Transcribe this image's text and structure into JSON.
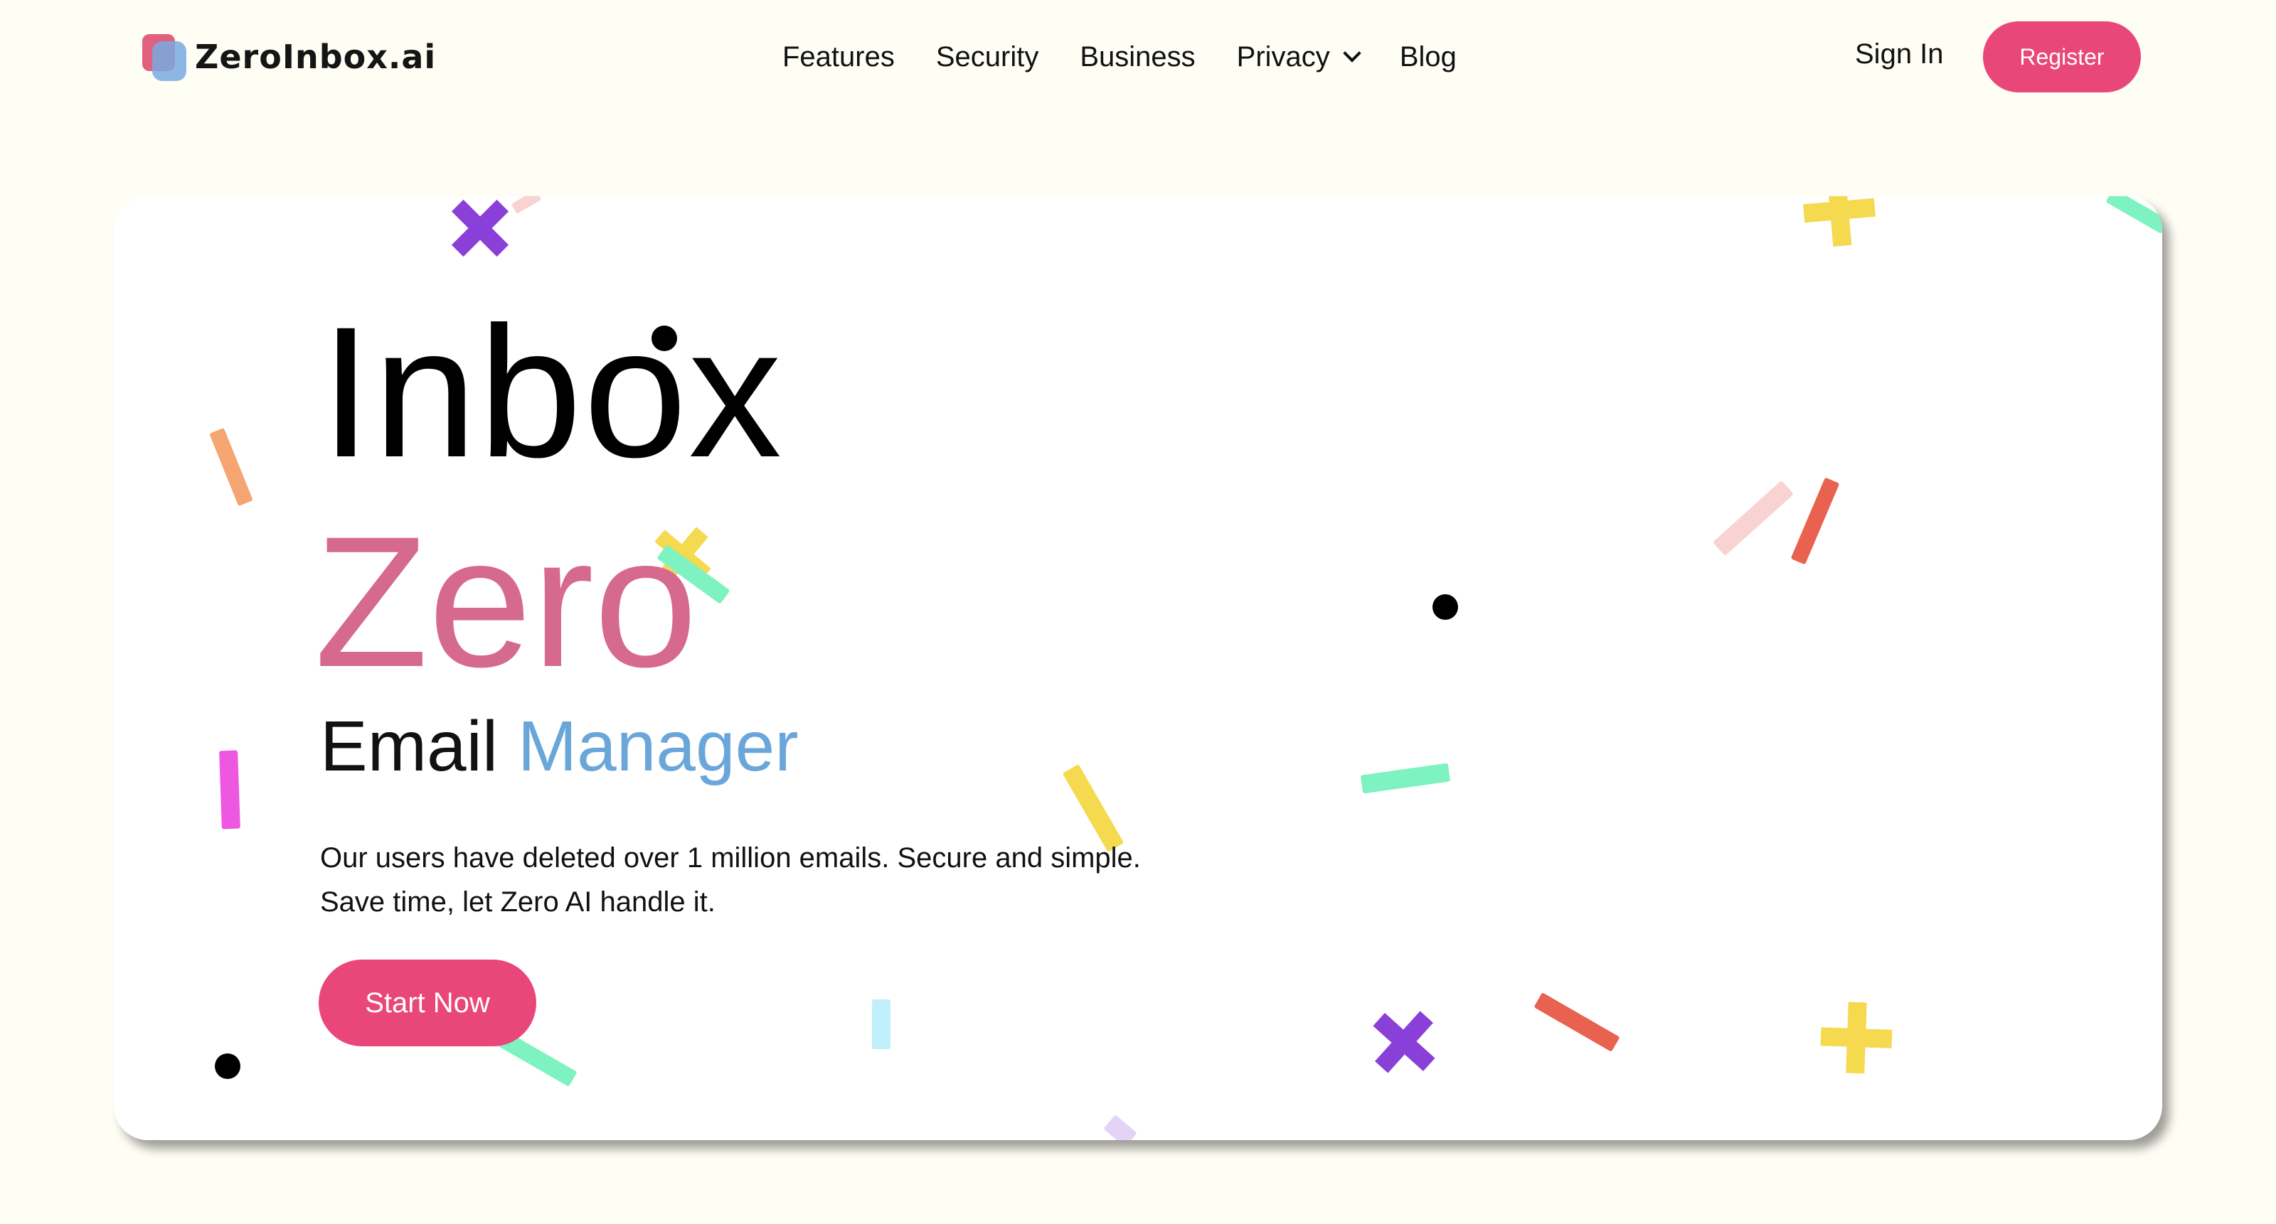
{
  "brand": {
    "name": "ZeroInbox.ai",
    "logo_colors": [
      "#e0607e",
      "#78aae1"
    ]
  },
  "nav": {
    "items": [
      {
        "label": "Features"
      },
      {
        "label": "Security"
      },
      {
        "label": "Business"
      },
      {
        "label": "Privacy",
        "has_dropdown": true
      },
      {
        "label": "Blog"
      }
    ]
  },
  "auth": {
    "signin_label": "Sign In",
    "register_label": "Register"
  },
  "hero": {
    "title_line1": "Inbox",
    "title_line2": "Zero",
    "subtitle_main": "Email",
    "subtitle_accent": "Manager",
    "description_line1": "Our users have deleted over 1 million emails. Secure and simple.",
    "description_line2": "Save time, let Zero AI handle it.",
    "cta_label": "Start Now"
  },
  "colors": {
    "accent": "#e9477a",
    "zero_pink": "#d6698e",
    "manager_blue": "#6aa6d9",
    "background": "#fffef5",
    "confetti": [
      "#8b3fd9",
      "#f5d94f",
      "#7ef2c0",
      "#f4a571",
      "#ee57e0",
      "#e8624f",
      "#f9d2d2",
      "#bff0fb",
      "#e4d3f7"
    ]
  }
}
